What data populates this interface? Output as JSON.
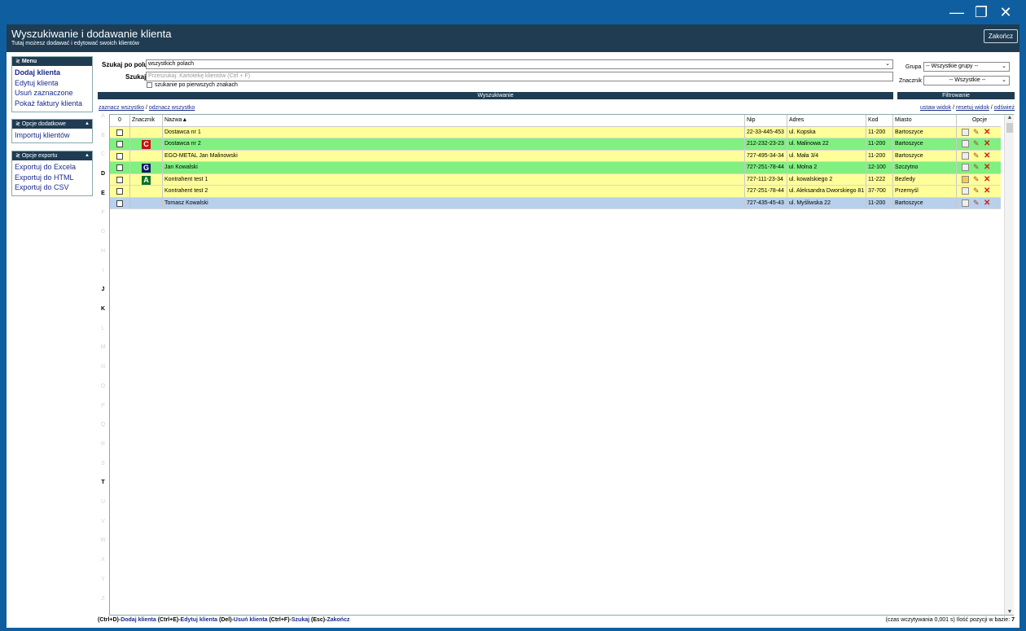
{
  "window": {
    "minimize": "—",
    "restore": "❐",
    "close": "✕"
  },
  "header": {
    "title": "Wyszukiwanie i dodawanie klienta",
    "subtitle": "Tutaj możesz dodawać i edytować swoich klientów",
    "close_label": "Zakończ"
  },
  "menu": {
    "title": "Menu",
    "items": [
      "Dodaj klienta",
      "Edytuj klienta",
      "Usuń zaznaczone",
      "Pokaż faktury klienta"
    ]
  },
  "extras": {
    "title": "Opcje dodatkowe",
    "items": [
      "Importuj klientów"
    ]
  },
  "export": {
    "title": "Opcje exportu",
    "items": [
      "Exportuj do Excela",
      "Exportuj do HTML",
      "Exportuj do CSV"
    ]
  },
  "search": {
    "field_label": "Szukaj po polu",
    "field_value": "wszystkich polach",
    "search_label": "Szukaj",
    "search_placeholder": "Przeszukaj: Kartotekę klientów (Ctrl + F)",
    "prefix_option": "szukanie po pierwszych znakach",
    "bar_label": "Wyszukiwanie"
  },
  "filter": {
    "group_label": "Grupa",
    "group_value": "-- Wszystkie grupy --",
    "marker_label": "Znacznik",
    "marker_value": "-- Wszystkie --",
    "bar_label": "Filtrowanie"
  },
  "links": {
    "select_all": "zaznacz wszystko",
    "deselect_all": "odznacz wszystko",
    "set_view": "ustaw widok",
    "reset_view": "resetuj widok",
    "refresh": "odśwież",
    "sep": "/"
  },
  "alphabet": [
    "A",
    "B",
    "C",
    "D",
    "E",
    "F",
    "G",
    "H",
    "I",
    "J",
    "K",
    "L",
    "M",
    "N",
    "O",
    "P",
    "Q",
    "R",
    "S",
    "T",
    "U",
    "V",
    "W",
    "X",
    "Y",
    "Z"
  ],
  "alphabet_active": [
    "D",
    "E",
    "J",
    "K",
    "T"
  ],
  "table": {
    "headers": {
      "check": "0",
      "marker": "Znacznik",
      "name": "Nazwa",
      "sort_arrow": "▲",
      "nip": "Nip",
      "address": "Adres",
      "code": "Kod",
      "city": "Miasto",
      "options": "Opcje"
    },
    "rows": [
      {
        "marker": "",
        "marker_color": "",
        "name": "Dostawca nr 1",
        "nip": "22-33-445-453",
        "address": "ul. Kopska",
        "code": "11-200",
        "city": "Bartoszyce",
        "bg": "#ffff99",
        "doc_color": "#eeeeee"
      },
      {
        "marker": "C",
        "marker_color": "#c81010",
        "name": "Dostawca nr 2",
        "nip": "212-232-23-23",
        "address": "ul. Malinowa 22",
        "code": "11-200",
        "city": "Bartoszyce",
        "bg": "#80f080",
        "doc_color": "#eeeeee"
      },
      {
        "marker": "",
        "marker_color": "",
        "name": "EGO-METAL Jan Malinowski",
        "nip": "727-495-34-34",
        "address": "ul. Mała 3/4",
        "code": "11-200",
        "city": "Bartoszyce",
        "bg": "#ffff99",
        "doc_color": "#eeeeee"
      },
      {
        "marker": "G",
        "marker_color": "#101868",
        "name": "Jan Kowalski",
        "nip": "727-251-78-44",
        "address": "ul. Molna 2",
        "code": "12-100",
        "city": "Szczytno",
        "bg": "#80f080",
        "doc_color": "#eeeeee"
      },
      {
        "marker": "A",
        "marker_color": "#107020",
        "name": "Kontrahent test 1",
        "nip": "727-111-23-34",
        "address": "ul. kowalskiego 2",
        "code": "11-222",
        "city": "Bezledy",
        "bg": "#ffff99",
        "doc_color": "#f0d040"
      },
      {
        "marker": "",
        "marker_color": "",
        "name": "Kontrahent test 2",
        "nip": "727-251-78-44",
        "address": "ul. Aleksandra Dworskiego 81",
        "code": "37-700",
        "city": "Przemyśl",
        "bg": "#ffff99",
        "doc_color": "#eeeeee"
      },
      {
        "marker": "",
        "marker_color": "",
        "name": "Tomasz Kowalski",
        "nip": "727-435-45-43",
        "address": "ul. Myśliwska 22",
        "code": "11-200",
        "city": "Bartoszyce",
        "bg": "#b8d0ec",
        "doc_color": "#eeeeee"
      }
    ]
  },
  "footer": {
    "shortcuts": [
      {
        "key": "(Ctrl+D)-",
        "action": "Dodaj klienta"
      },
      {
        "key": " (Ctrl+E)-",
        "action": "Edytuj klienta"
      },
      {
        "key": " (Del)-",
        "action": "Usuń klienta"
      },
      {
        "key": " (Ctrl+F)-",
        "action": "Szukaj"
      },
      {
        "key": " (Esc)-",
        "action": "Zakończ"
      }
    ],
    "load_time": "(czas wczytywania 0,001 s) Ilość pozycji w bazie: ",
    "count": "7"
  }
}
